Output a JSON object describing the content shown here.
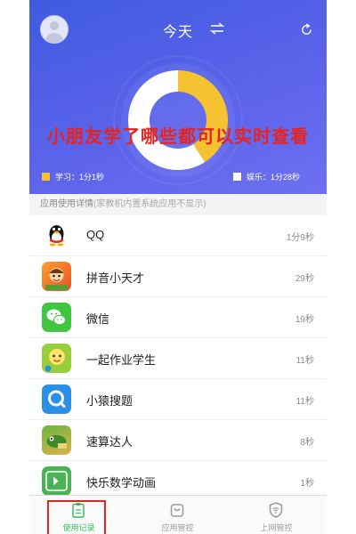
{
  "header": {
    "title": "今天",
    "swap_icon": "swap-arrows-icon",
    "refresh_icon": "refresh-icon",
    "avatar_icon": "default-avatar-icon"
  },
  "overlay_caption": "小朋友学了哪些都可以实时查看",
  "chart_data": {
    "type": "pie",
    "labels": [
      "学习：1分1秒",
      "娱乐：1分28秒"
    ],
    "values": [
      61,
      88
    ],
    "colors": [
      "#f5c232",
      "#ffffff"
    ]
  },
  "legend": {
    "study": "学习：1分1秒",
    "play": "娱乐：1分28秒"
  },
  "section": {
    "title": "应用使用详情",
    "note": "(家教机内置系统应用不显示)"
  },
  "apps": [
    {
      "name": "QQ",
      "time": "1分9秒",
      "icon": "qq-penguin-icon"
    },
    {
      "name": "拼音小天才",
      "time": "29秒",
      "icon": "pinyin-app-icon"
    },
    {
      "name": "微信",
      "time": "19秒",
      "icon": "wechat-icon"
    },
    {
      "name": "一起作业学生",
      "time": "11秒",
      "icon": "yiqizuoye-icon"
    },
    {
      "name": "小猿搜题",
      "time": "11秒",
      "icon": "xiaoyuan-search-icon"
    },
    {
      "name": "速算达人",
      "time": "8秒",
      "icon": "susuan-app-icon"
    },
    {
      "name": "快乐数学动画",
      "time": "1秒",
      "icon": "happy-math-icon"
    }
  ],
  "tabs": [
    {
      "label": "使用记录",
      "icon": "clipboard-icon",
      "active": true
    },
    {
      "label": "应用管控",
      "icon": "bag-icon",
      "active": false
    },
    {
      "label": "上网管控",
      "icon": "shield-wifi-icon",
      "active": false
    }
  ],
  "colors": {
    "header_gradient_start": "#3f5be0",
    "header_gradient_end": "#6d70f0",
    "study": "#f5c232",
    "active_tab": "#37c05a",
    "overlay_text": "#e8231e"
  }
}
